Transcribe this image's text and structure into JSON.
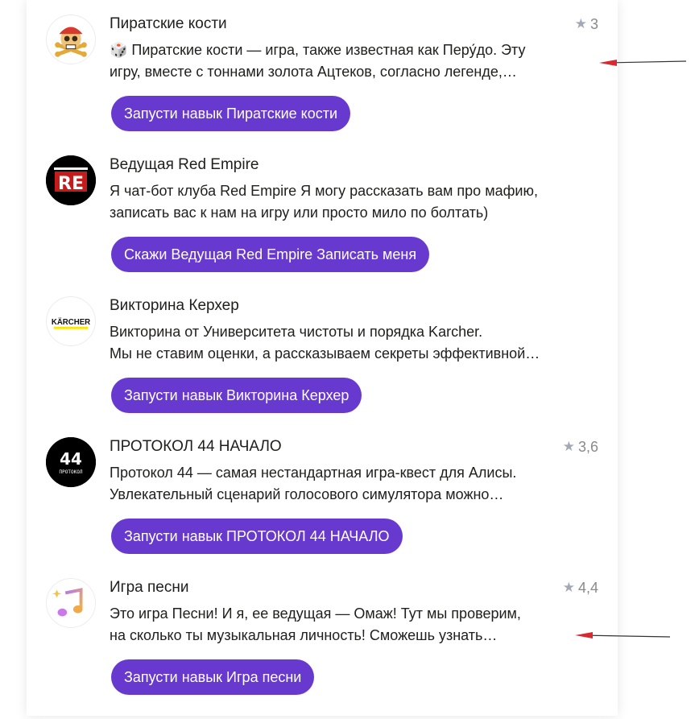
{
  "skills": [
    {
      "title": "Пиратские кости",
      "rating": "3",
      "description_line1": "🎲 Пиратские кости — игра, также известная как Перу́до. Эту",
      "description_line2": "игру, вместе с тоннами золота Ацтеков, согласно легенде,…",
      "button": "Запусти навык Пиратские кости",
      "icon": "pirate-skull-icon"
    },
    {
      "title": "Ведущая Red Empire",
      "rating": "",
      "description_line1": "Я чат-бот клуба Red Empire Я могу рассказать вам про мафию,",
      "description_line2": "записать вас к нам на игру или просто мило по болтать)",
      "button": "Скажи Ведущая Red Empire Записать меня",
      "icon": "red-empire-logo-icon"
    },
    {
      "title": "Викторина Керхер",
      "rating": "",
      "description_line1": "Викторина от Университета чистоты и порядка Karcher.",
      "description_line2": "Мы не ставим оценки, а рассказываем секреты эффективной…",
      "button": "Запусти навык Викторина Керхер",
      "icon": "karcher-logo-icon",
      "logo_text": "KÄRCHER"
    },
    {
      "title": "ПРОТОКОЛ 44 НАЧАЛО",
      "rating": "3,6",
      "description_line1": "Протокол 44 — самая нестандартная игра-квест для Алисы.",
      "description_line2": "Увлекательный сценарий голосового симулятора можно…",
      "button": "Запусти навык ПРОТОКОЛ 44 НАЧАЛО",
      "icon": "protocol-44-logo-icon",
      "logo_text": "44",
      "logo_subtext": "ПРОТОКОЛ"
    },
    {
      "title": "Игра песни",
      "rating": "4,4",
      "description_line1": "Это игра Песни! И я, ее ведущая — Омаж! Тут мы проверим,",
      "description_line2": "на сколько ты музыкальная личность! Сможешь узнать…",
      "button": "Запусти навык Игра песни",
      "icon": "music-note-icon"
    }
  ],
  "colors": {
    "button": "#6839cf",
    "annotation_arrow": "#d9282f",
    "star": "#a3a8b6"
  }
}
